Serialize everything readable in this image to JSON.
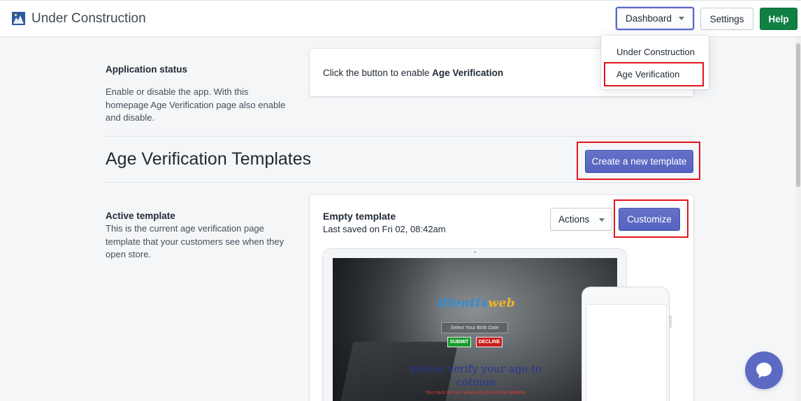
{
  "app": {
    "title": "Under Construction"
  },
  "header": {
    "dashboard_label": "Dashboard",
    "settings_label": "Settings",
    "help_label": "Help"
  },
  "dashboard_menu": {
    "items": [
      {
        "label": "Under Construction"
      },
      {
        "label": "Age Verification"
      }
    ]
  },
  "app_status": {
    "title": "Application status",
    "description": "Enable or disable the app. With this homepage Age Verification page also enable and disable.",
    "card_text_prefix": "Click the button to enable ",
    "card_text_bold": "Age Verification"
  },
  "templates": {
    "heading": "Age Verification Templates",
    "create_label": "Create a new template"
  },
  "active_template": {
    "title": "Active template",
    "description": "This is the current age verification page template that your customers see when they open store.",
    "name": "Empty template",
    "saved": "Last saved on Fri 02, 08:42am",
    "actions_label": "Actions",
    "customize_label": "Customize"
  },
  "preview": {
    "logo_part1": "iDentix",
    "logo_part2": "web",
    "birth_placeholder": "Select Your Birth Date",
    "submit_label": "SUBMIT",
    "decline_label": "DECLINE",
    "verify_text": "please verify your age to cotinue",
    "warning_text": "You must be 18+ years old to visit this website."
  },
  "colors": {
    "primary": "#5c6ac4",
    "help_green": "#108043",
    "highlight_red": "#e3141b"
  }
}
